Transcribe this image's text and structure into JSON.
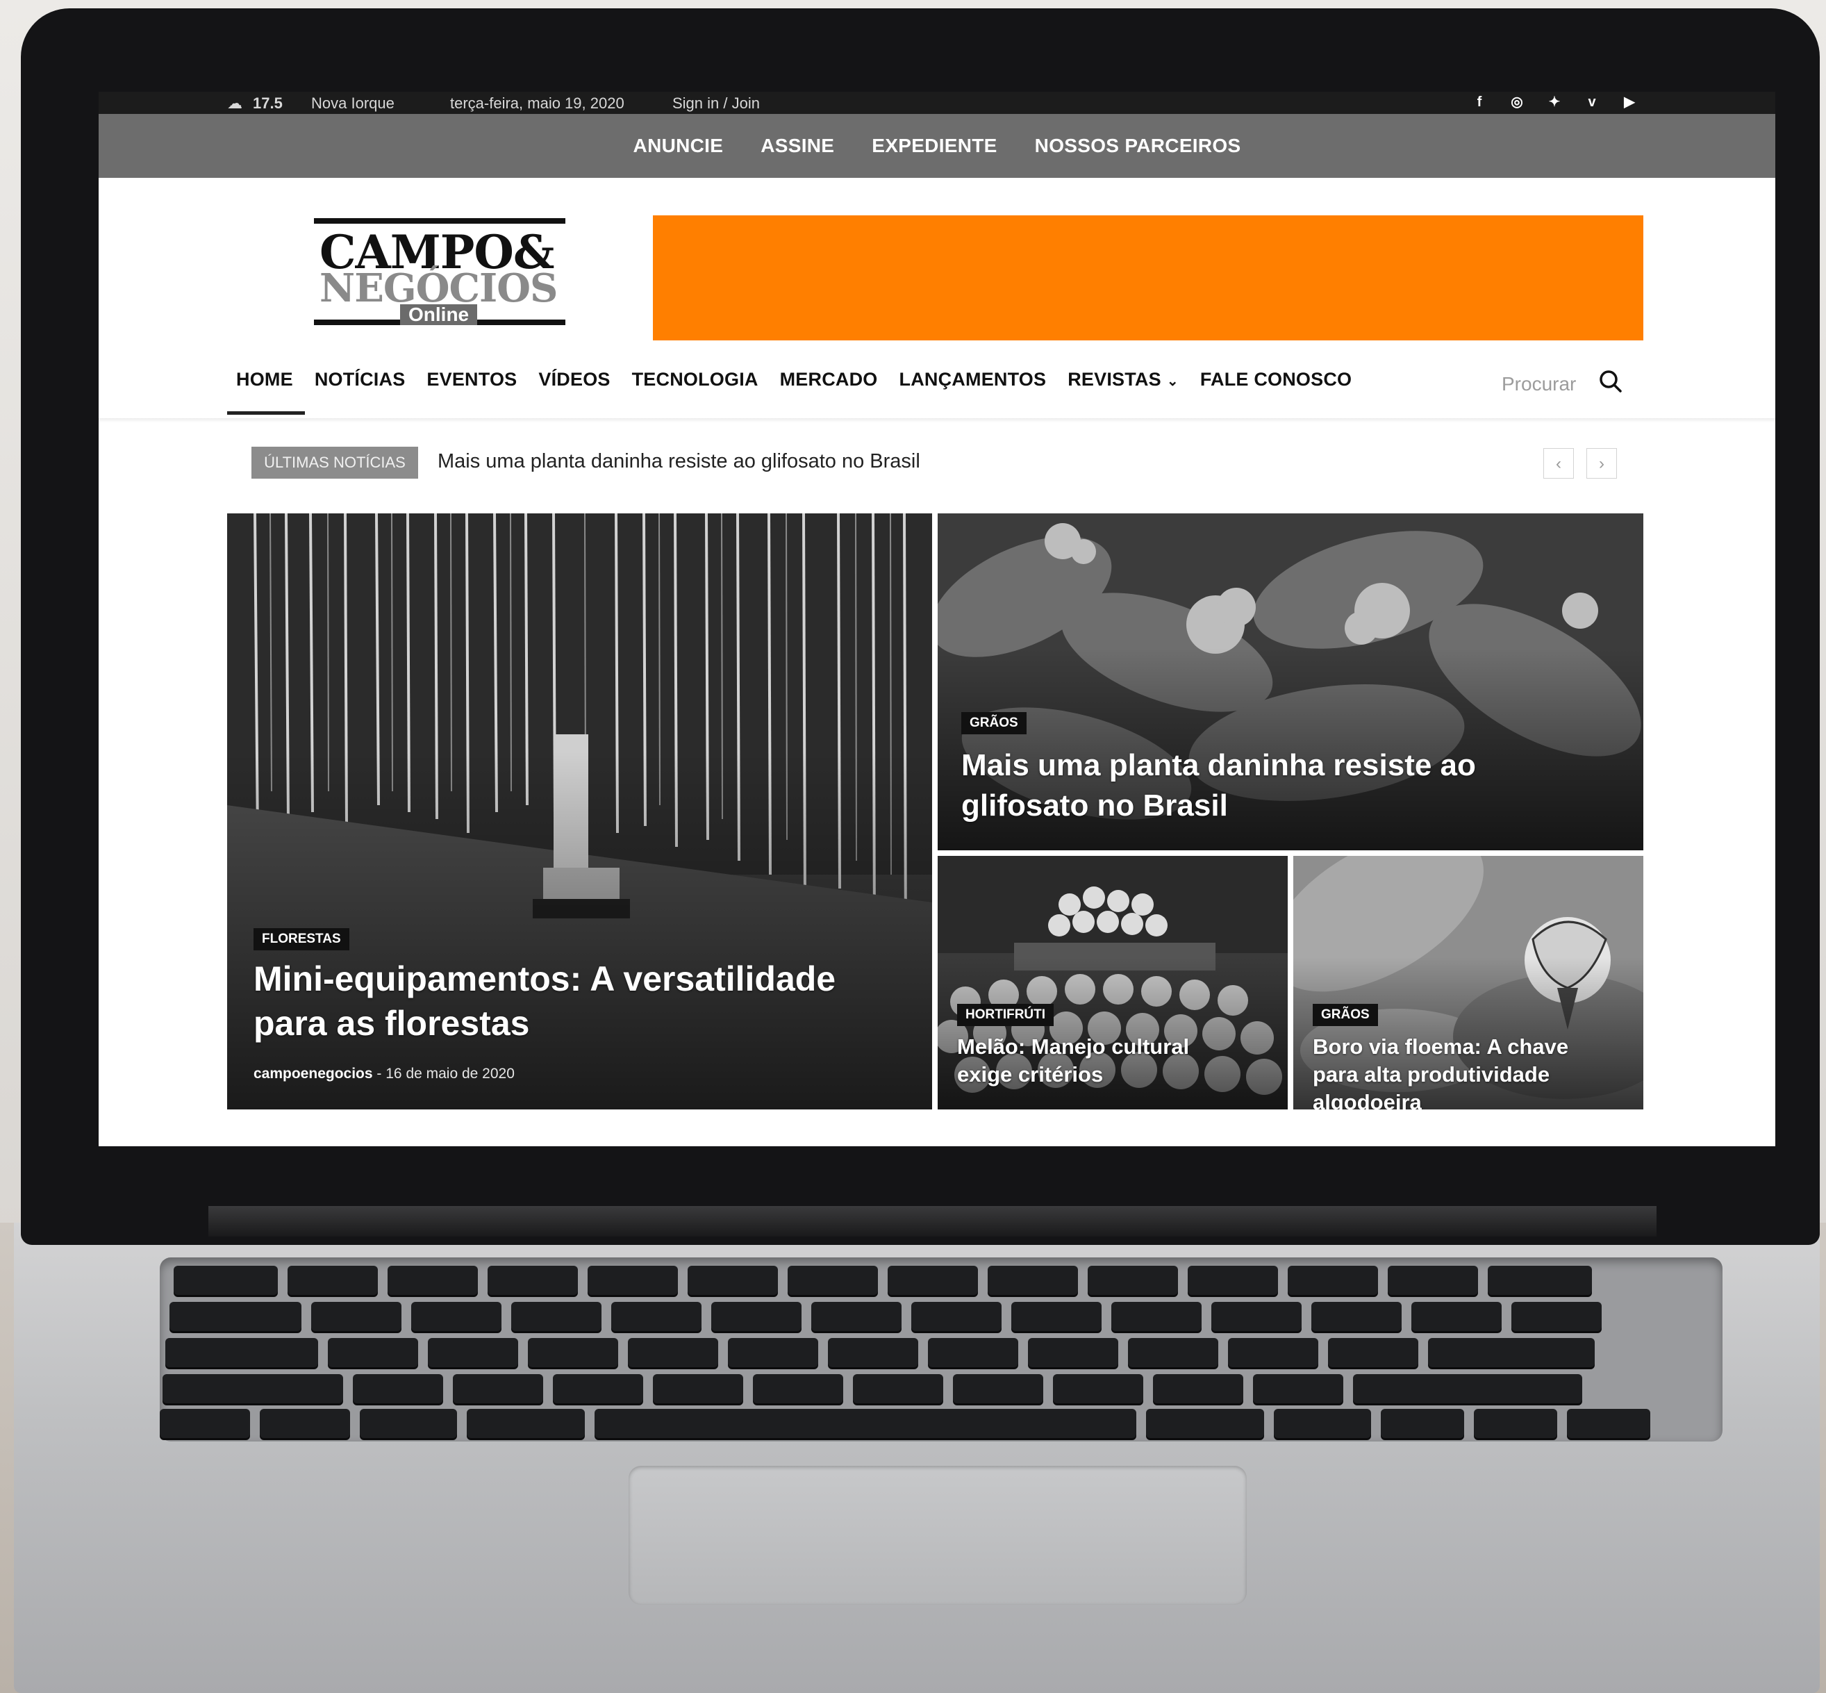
{
  "topbar": {
    "temperature": "17.5",
    "city": "Nova Iorque",
    "date": "terça-feira, maio 19, 2020",
    "signin": "Sign in / Join",
    "social_icons": [
      "facebook-icon",
      "instagram-icon",
      "twitter-icon",
      "vimeo-icon",
      "youtube-icon"
    ]
  },
  "menubar": {
    "items": [
      "ANUNCIE",
      "ASSINE",
      "EXPEDIENTE",
      "NOSSOS PARCEIROS"
    ]
  },
  "logo": {
    "line1": "CAMPO&",
    "line2": "NEGÓCIOS",
    "line3": "Online"
  },
  "ad": {
    "color": "#ff7f00"
  },
  "nav": {
    "items": [
      "HOME",
      "NOTÍCIAS",
      "EVENTOS",
      "VÍDEOS",
      "TECNOLOGIA",
      "MERCADO",
      "LANÇAMENTOS",
      "REVISTAS",
      "FALE CONOSCO"
    ],
    "active": "HOME",
    "search_placeholder": "Procurar"
  },
  "ticker": {
    "label": "ÚLTIMAS NOTÍCIAS",
    "text": "Mais uma planta daninha resiste ao glifosato no Brasil",
    "prev": "‹",
    "next": "›"
  },
  "featured": [
    {
      "category": "FLORESTAS",
      "title": "Mini-equipamentos: A versatilidade para as florestas",
      "author": "campoenegocios",
      "separator": "-",
      "date": "16 de maio de 2020"
    },
    {
      "category": "GRÃOS",
      "title": "Mais uma planta daninha resiste ao glifosato no Brasil"
    },
    {
      "category": "HORTIFRÚTI",
      "title": "Melão: Manejo cultural exige critérios"
    },
    {
      "category": "GRÃOS",
      "title": "Boro via floema: A chave para alta produtividade algodoeira"
    }
  ]
}
